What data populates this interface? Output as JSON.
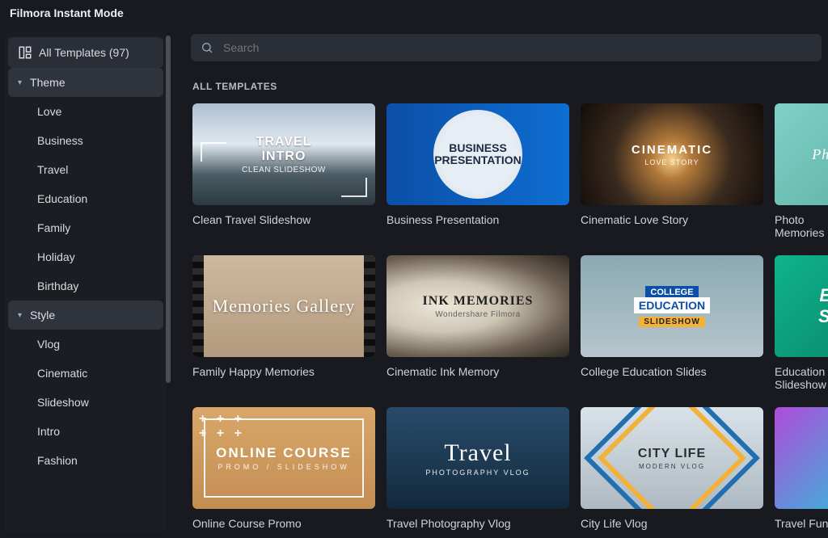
{
  "app": {
    "title": "Filmora Instant Mode"
  },
  "search": {
    "placeholder": "Search"
  },
  "sidebar": {
    "all_label": "All Templates (97)",
    "groups": [
      {
        "label": "Theme",
        "items": [
          {
            "label": "Love"
          },
          {
            "label": "Business"
          },
          {
            "label": "Travel"
          },
          {
            "label": "Education"
          },
          {
            "label": "Family"
          },
          {
            "label": "Holiday"
          },
          {
            "label": "Birthday"
          }
        ]
      },
      {
        "label": "Style",
        "items": [
          {
            "label": "Vlog"
          },
          {
            "label": "Cinematic"
          },
          {
            "label": "Slideshow"
          },
          {
            "label": "Intro"
          },
          {
            "label": "Fashion"
          }
        ]
      }
    ]
  },
  "main": {
    "section_title": "ALL TEMPLATES",
    "cards": [
      {
        "label": "Clean Travel Slideshow",
        "thumb_line1": "TRAVEL",
        "thumb_sub": "INTRO",
        "thumb_line2": "CLEAN SLIDESHOW"
      },
      {
        "label": "Business Presentation",
        "thumb_line1": "BUSINESS",
        "thumb_sub": "PRESENTATION",
        "thumb_line2": ""
      },
      {
        "label": "Cinematic Love Story",
        "thumb_line1": "CINEMATIC",
        "thumb_sub": "",
        "thumb_line2": "LOVE STORY"
      },
      {
        "label": "Photo Memories",
        "thumb_line1": "Photo Memories",
        "thumb_sub": "",
        "thumb_line2": ""
      },
      {
        "label": "Family Happy Memories",
        "thumb_line1": "Memories Gallery",
        "thumb_sub": "",
        "thumb_line2": ""
      },
      {
        "label": "Cinematic Ink Memory",
        "thumb_line1": "INK MEMORIES",
        "thumb_sub": "",
        "thumb_line2": "Wondershare Filmora"
      },
      {
        "label": "College Education Slides",
        "thumb_line1": "COLLEGE",
        "thumb_sub": "EDUCATION",
        "thumb_line2": "SLIDESHOW"
      },
      {
        "label": "Education Slideshow",
        "thumb_line1": "Education",
        "thumb_sub": "Slideshow",
        "thumb_line2": ""
      },
      {
        "label": "Online Course Promo",
        "thumb_line1": "ONLINE COURSE",
        "thumb_sub": "",
        "thumb_line2": "PROMO / SLIDESHOW"
      },
      {
        "label": "Travel Photography Vlog",
        "thumb_line1": "Travel",
        "thumb_sub": "",
        "thumb_line2": "PHOTOGRAPHY VLOG"
      },
      {
        "label": "City Life Vlog",
        "thumb_line1": "CITY LIFE",
        "thumb_sub": "",
        "thumb_line2": "MODERN VLOG"
      },
      {
        "label": "Travel Fun",
        "thumb_line1": "",
        "thumb_sub": "",
        "thumb_line2": ""
      }
    ]
  }
}
